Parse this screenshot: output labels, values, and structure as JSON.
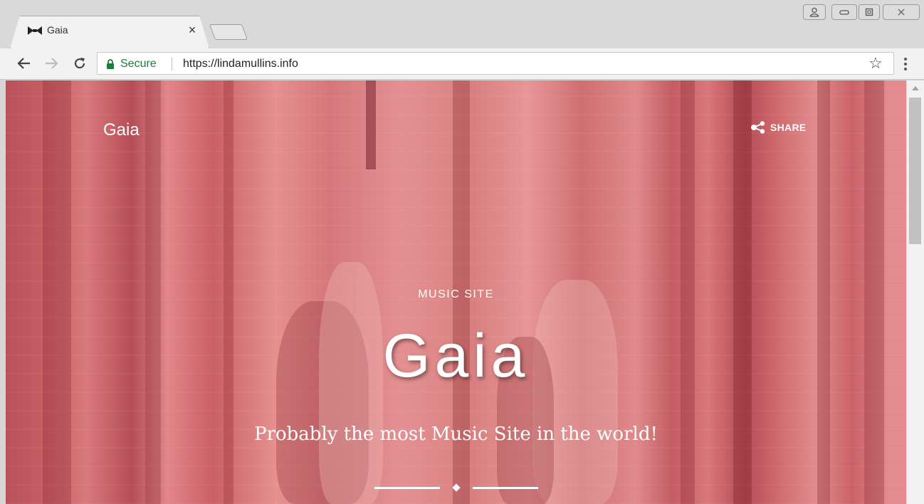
{
  "browser": {
    "tab": {
      "title": "Gaia",
      "close": "×"
    },
    "address_bar": {
      "secure_label": "Secure",
      "url": "https://lindamullins.info"
    },
    "bookmark_star": "☆"
  },
  "site": {
    "logo": "Gaia",
    "share_label": "SHARE",
    "kicker": "MUSIC SITE",
    "title": "Gaia",
    "tagline": "Probably the most Music Site in the world!"
  },
  "colors": {
    "overlay_red": "#d5777a",
    "secure_green": "#188038",
    "chrome_gray": "#d9d9d9"
  },
  "icons": [
    "bowtie-favicon-icon",
    "back-arrow-icon",
    "forward-arrow-icon",
    "reload-icon",
    "lock-icon",
    "star-icon",
    "menu-dots-icon",
    "share-icon",
    "user-icon",
    "minimize-icon",
    "maximize-icon",
    "close-window-icon"
  ]
}
